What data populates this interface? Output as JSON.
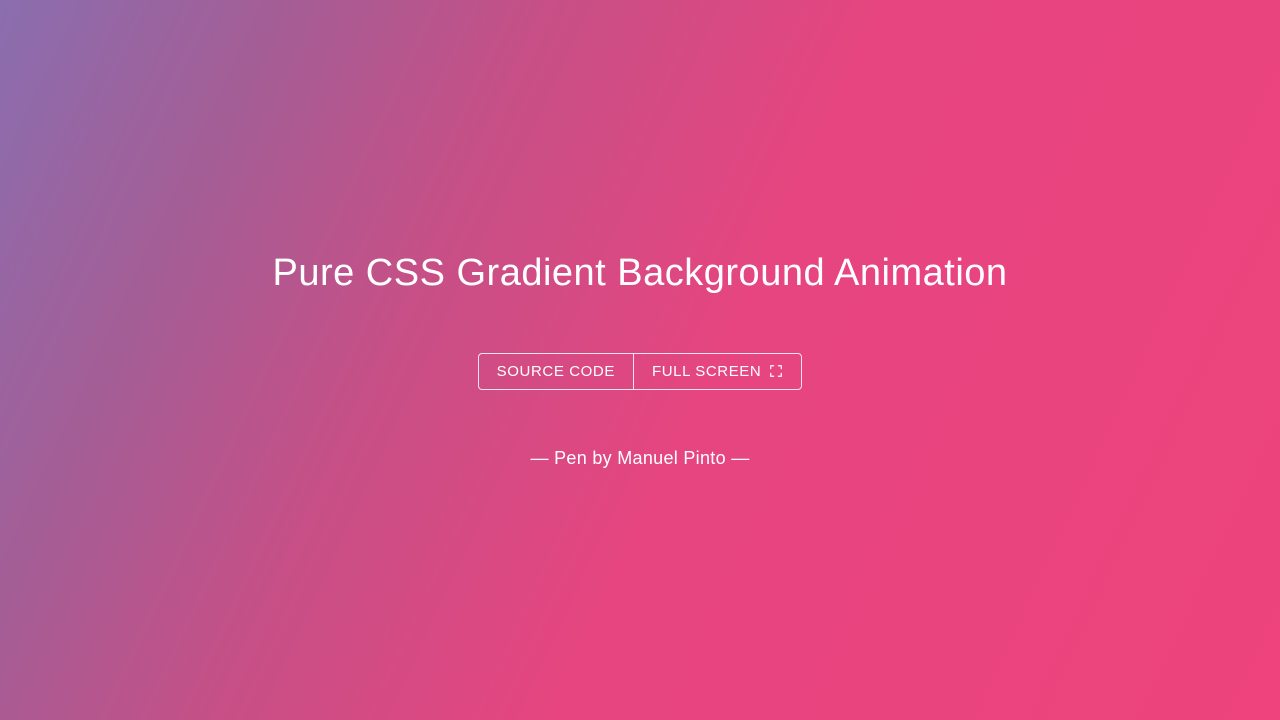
{
  "title": "Pure CSS Gradient Background Animation",
  "buttons": {
    "source_code": "SOURCE CODE",
    "full_screen": "FULL SCREEN"
  },
  "credit": "— Pen by Manuel Pinto —"
}
